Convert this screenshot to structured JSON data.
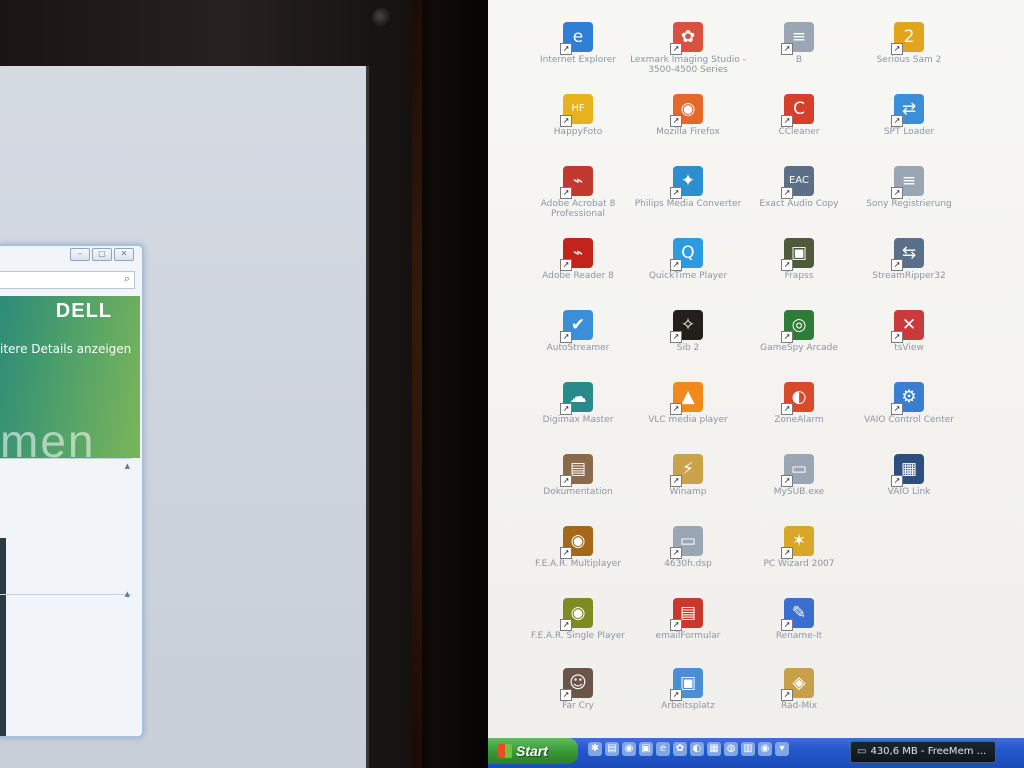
{
  "left_monitor": {
    "window_controls": [
      "–",
      "▢",
      "✕"
    ],
    "brand": "DELL",
    "banner_text": "itere Details anzeigen",
    "banner_big_text": "men"
  },
  "desktop_icons": [
    {
      "label": "Internet Explorer",
      "icon": "internet-explorer-icon",
      "glyph": "e",
      "color": "#2f7fd6",
      "col": 0,
      "row": 0
    },
    {
      "label": "Lexmark Imaging Studio - 3500-4500 Series",
      "icon": "lexmark-flower-icon",
      "glyph": "✿",
      "color": "#d8523f",
      "col": 1,
      "row": 0
    },
    {
      "label": "B",
      "icon": "text-document-icon",
      "glyph": "≡",
      "color": "#9aa6b4",
      "col": 2,
      "row": 0
    },
    {
      "label": "Serious Sam 2",
      "icon": "serious-sam-badge-icon",
      "glyph": "2",
      "color": "#e0a51c",
      "col": 3,
      "row": 0
    },
    {
      "label": "HappyFoto",
      "icon": "happyfoto-icon",
      "glyph": "HF",
      "color": "#e7b21c",
      "col": 0,
      "row": 1
    },
    {
      "label": "Mozilla Firefox",
      "icon": "firefox-icon",
      "glyph": "◉",
      "color": "#e4682a",
      "col": 1,
      "row": 1
    },
    {
      "label": "CCleaner",
      "icon": "ccleaner-icon",
      "glyph": "C",
      "color": "#d6402a",
      "col": 2,
      "row": 1
    },
    {
      "label": "SPT Loader",
      "icon": "spt-loader-icon",
      "glyph": "⇄",
      "color": "#3b8fd8",
      "col": 3,
      "row": 1
    },
    {
      "label": "Adobe Acrobat 8 Professional",
      "icon": "acrobat-document-icon",
      "glyph": "⌁",
      "color": "#c23a2f",
      "col": 0,
      "row": 2
    },
    {
      "label": "Philips Media Converter",
      "icon": "media-converter-icon",
      "glyph": "✦",
      "color": "#2e8fcf",
      "col": 1,
      "row": 2
    },
    {
      "label": "Exact Audio Copy",
      "icon": "eac-disc-icon",
      "glyph": "EAC",
      "color": "#5c6f86",
      "col": 2,
      "row": 2
    },
    {
      "label": "Sony Registrierung",
      "icon": "registration-document-icon",
      "glyph": "≡",
      "color": "#9aa6b4",
      "col": 3,
      "row": 2
    },
    {
      "label": "Adobe Reader 8",
      "icon": "adobe-reader-icon",
      "glyph": "⌁",
      "color": "#c2241c",
      "col": 0,
      "row": 3
    },
    {
      "label": "QuickTime Player",
      "icon": "quicktime-icon",
      "glyph": "Q",
      "color": "#2e9ae0",
      "col": 1,
      "row": 3
    },
    {
      "label": "Frapss",
      "icon": "fraps-monitor-icon",
      "glyph": "▣",
      "color": "#4d5b3a",
      "col": 2,
      "row": 3
    },
    {
      "label": "StreamRipper32",
      "icon": "streamripper-icon",
      "glyph": "⇆",
      "color": "#5a6f88",
      "col": 3,
      "row": 3
    },
    {
      "label": "AutoStreamer",
      "icon": "autostreamer-icon",
      "glyph": "✔",
      "color": "#3a8fd8",
      "col": 0,
      "row": 4
    },
    {
      "label": "Sib 2",
      "icon": "sib-figure-icon",
      "glyph": "✧",
      "color": "#23201c",
      "col": 1,
      "row": 4
    },
    {
      "label": "GameSpy Arcade",
      "icon": "gamespy-icon",
      "glyph": "◎",
      "color": "#2e7d36",
      "col": 2,
      "row": 4
    },
    {
      "label": "tsView",
      "icon": "tsview-red-x-icon",
      "glyph": "✕",
      "color": "#c93a3a",
      "col": 3,
      "row": 4
    },
    {
      "label": "Digimax Master",
      "icon": "digimax-camera-icon",
      "glyph": "☁",
      "color": "#2a8a8a",
      "col": 0,
      "row": 5
    },
    {
      "label": "VLC media player",
      "icon": "vlc-cone-icon",
      "glyph": "▲",
      "color": "#f08a1c",
      "col": 1,
      "row": 5
    },
    {
      "label": "ZoneAlarm",
      "icon": "zonealarm-icon",
      "glyph": "◐",
      "color": "#d84a2a",
      "col": 2,
      "row": 5
    },
    {
      "label": "VAIO Control Center",
      "icon": "gear-icon",
      "glyph": "⚙",
      "color": "#3a7fcf",
      "col": 3,
      "row": 5
    },
    {
      "label": "Dokumentation",
      "icon": "documentation-bag-icon",
      "glyph": "▤",
      "color": "#8a6a4a",
      "col": 0,
      "row": 6
    },
    {
      "label": "Winamp",
      "icon": "winamp-icon",
      "glyph": "⚡",
      "color": "#caa24a",
      "col": 1,
      "row": 6
    },
    {
      "label": "MySUB.exe",
      "icon": "file-document-icon",
      "glyph": "▭",
      "color": "#9aa6b4",
      "col": 2,
      "row": 6
    },
    {
      "label": "VAIO Link",
      "icon": "vaio-link-icon",
      "glyph": "▦",
      "color": "#2c4f7e",
      "col": 3,
      "row": 6
    },
    {
      "label": "F.E.A.R. Multiplayer",
      "icon": "fear-eye-icon",
      "glyph": "◉",
      "color": "#a5681a",
      "col": 0,
      "row": 7
    },
    {
      "label": "4630h.dsp",
      "icon": "dsp-document-icon",
      "glyph": "▭",
      "color": "#9aa6b4",
      "col": 1,
      "row": 7
    },
    {
      "label": "PC Wizard 2007",
      "icon": "pc-wizard-icon",
      "glyph": "✶",
      "color": "#d7a62a",
      "col": 2,
      "row": 7
    },
    {
      "label": "F.E.A.R. Single Player",
      "icon": "fear-eye-icon",
      "glyph": "◉",
      "color": "#7e8a22",
      "col": 0,
      "row": 8
    },
    {
      "label": "emailFormular",
      "icon": "pdf-document-icon",
      "glyph": "▤",
      "color": "#c7392c",
      "col": 1,
      "row": 8
    },
    {
      "label": "Rename-It",
      "icon": "rename-pencil-icon",
      "glyph": "✎",
      "color": "#3b6fcf",
      "col": 2,
      "row": 8
    },
    {
      "label": "Far Cry",
      "icon": "far-cry-face-icon",
      "glyph": "☺",
      "color": "#6b5548",
      "col": 0,
      "row": 9
    },
    {
      "label": "Arbeitsplatz",
      "icon": "my-computer-icon",
      "glyph": "▣",
      "color": "#4a8fd6",
      "col": 1,
      "row": 9
    },
    {
      "label": "Rad-Mix",
      "icon": "rad-mix-icon",
      "glyph": "◈",
      "color": "#c9a04a",
      "col": 2,
      "row": 9
    }
  ],
  "taskbar": {
    "start_label": "Start",
    "quick_launch": [
      {
        "icon": "quick-launch-icon-1",
        "glyph": "✱"
      },
      {
        "icon": "quick-launch-icon-2",
        "glyph": "▤"
      },
      {
        "icon": "quick-launch-icon-3",
        "glyph": "◉"
      },
      {
        "icon": "quick-launch-icon-4",
        "glyph": "▣"
      },
      {
        "icon": "quick-launch-ie-icon",
        "glyph": "e"
      },
      {
        "icon": "quick-launch-icon-6",
        "glyph": "✿"
      },
      {
        "icon": "quick-launch-icon-7",
        "glyph": "◐"
      },
      {
        "icon": "quick-launch-icon-8",
        "glyph": "▦"
      },
      {
        "icon": "quick-launch-icon-9",
        "glyph": "◍"
      },
      {
        "icon": "quick-launch-icon-10",
        "glyph": "▥"
      },
      {
        "icon": "quick-launch-firefox-icon",
        "glyph": "◉"
      },
      {
        "icon": "quick-launch-icon-12",
        "glyph": "▾"
      }
    ],
    "task_label": "430,6 MB - FreeMem ..."
  }
}
